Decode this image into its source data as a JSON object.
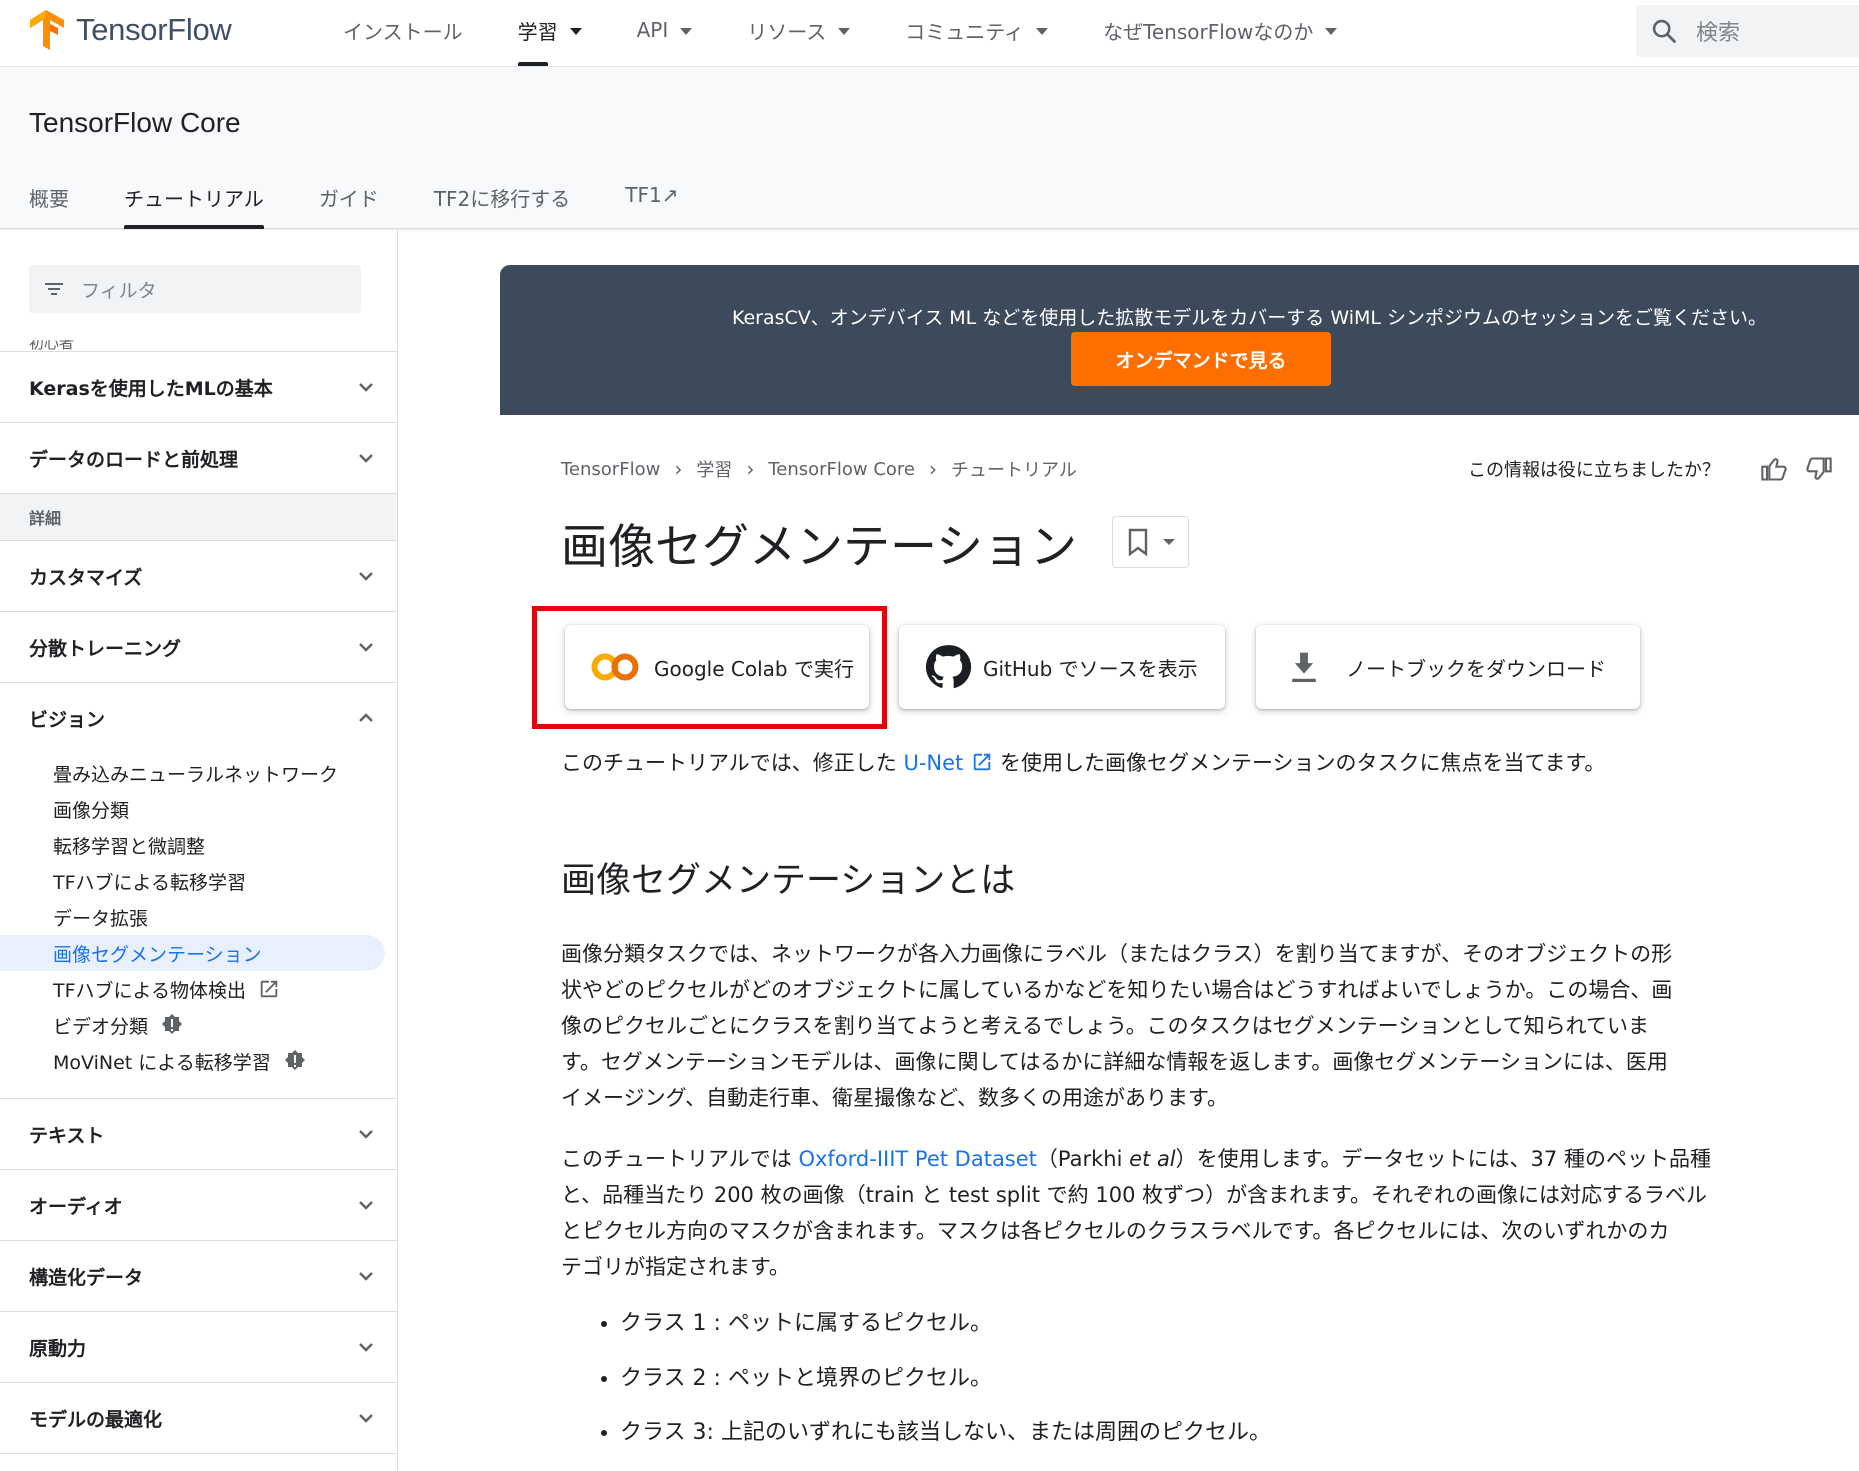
{
  "header": {
    "logo_text": "TensorFlow",
    "nav": [
      {
        "label": "インストール",
        "dropdown": false
      },
      {
        "label": "学習",
        "dropdown": true,
        "active": true
      },
      {
        "label": "API",
        "dropdown": true
      },
      {
        "label": "リソース",
        "dropdown": true
      },
      {
        "label": "コミュニティ",
        "dropdown": true
      },
      {
        "label": "なぜTensorFlowなのか",
        "dropdown": true
      }
    ],
    "search_placeholder": "検索"
  },
  "subheader": {
    "product_title": "TensorFlow Core",
    "tabs": [
      "概要",
      "チュートリアル",
      "ガイド",
      "TF2に移行する",
      "TF1↗"
    ],
    "active_tab": "チュートリアル"
  },
  "sidebar": {
    "filter_placeholder": "フィルタ",
    "cut_label": "初心者",
    "groups_top": [
      "Kerasを使用したMLの基本",
      "データのロードと前処理"
    ],
    "section_label": "詳細",
    "groups_mid": [
      "カスタマイズ",
      "分散トレーニング"
    ],
    "expanded_group": "ビジョン",
    "vision_items": [
      "畳み込みニューラルネットワーク",
      "画像分類",
      "転移学習と微調整",
      "TFハブによる転移学習",
      "データ拡張",
      "画像セグメンテーション",
      "TFハブによる物体検出",
      "ビデオ分類",
      "MoViNet による転移学習"
    ],
    "active_item": "画像セグメンテーション",
    "groups_bottom": [
      "テキスト",
      "オーディオ",
      "構造化データ",
      "原動力",
      "モデルの最適化"
    ]
  },
  "banner": {
    "text": "KerasCV、オンデバイス ML などを使用した拡散モデルをカバーする WiML シンポジウムのセッションをご覧ください。",
    "button_label": "オンデマンドで見る",
    "bg_color": "#3c4a5c",
    "button_color": "#ff6f00"
  },
  "breadcrumb": [
    "TensorFlow",
    "学習",
    "TensorFlow Core",
    "チュートリアル"
  ],
  "feedback_question": "この情報は役に立ちましたか？",
  "page_title": "画像セグメンテーション",
  "notebook_buttons": {
    "colab": "Google Colab で実行",
    "github": "GitHub でソースを表示",
    "download": "ノートブックをダウンロード"
  },
  "intro": {
    "before": "このチュートリアルでは、修正した ",
    "link": "U-Net",
    "after": " を使用した画像セグメンテーションのタスクに焦点を当てます。"
  },
  "section_heading": "画像セグメンテーションとは",
  "para1_lines": [
    "画像分類タスクでは、ネットワークが各入力画像にラベル（またはクラス）を割り当てますが、そのオブジェクトの形",
    "状やどのピクセルがどのオブジェクトに属しているかなどを知りたい場合はどうすればよいでしょうか。この場合、画",
    "像のピクセルごとにクラスを割り当てようと考えるでしょう。このタスクはセグメンテーションとして知られていま",
    "す。セグメンテーションモデルは、画像に関してはるかに詳細な情報を返します。画像セグメンテーションには、医用",
    "イメージング、自動走行車、衛星撮像など、数多くの用途があります。"
  ],
  "para2": {
    "l1_before": "このチュートリアルでは ",
    "l1_link": "Oxford-IIIT Pet Dataset",
    "l1_paren_open": "（Parkhi ",
    "l1_italic": "et al",
    "l1_after": "）を使用します。データセットには、37 種のペット品種",
    "lines": [
      "と、品種当たり 200 枚の画像（train と test split で約 100 枚ずつ）が含まれます。それぞれの画像には対応するラベル",
      "とピクセル方向のマスクが含まれます。マスクは各ピクセルのクラスラベルです。各ピクセルには、次のいずれかのカ",
      "テゴリが指定されます。"
    ]
  },
  "bullets": [
    "クラス 1 : ペットに属するピクセル。",
    "クラス 2 : ペットと境界のピクセル。",
    "クラス 3: 上記のいずれにも該当しない、または周囲のピクセル。"
  ],
  "colors": {
    "link": "#1a73e8",
    "highlight_box": "#e0060b",
    "tf_orange": "#ff6f00"
  }
}
